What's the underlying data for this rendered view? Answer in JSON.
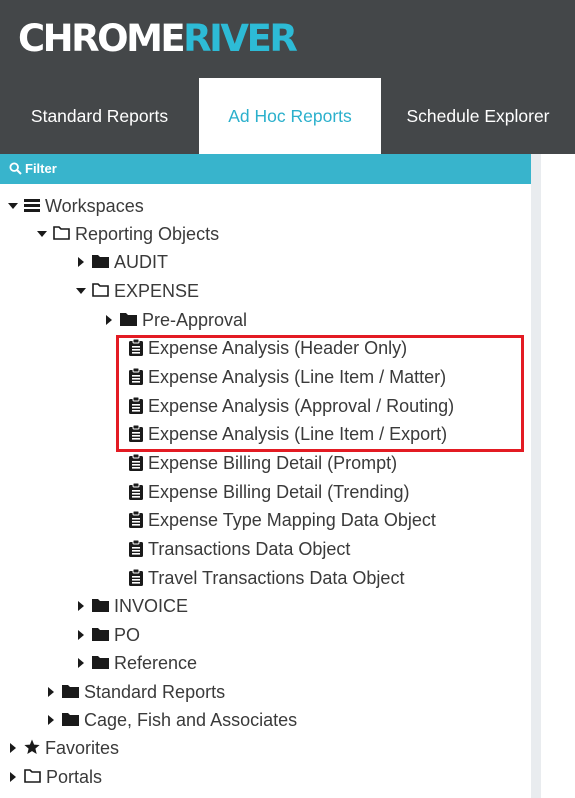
{
  "logo": {
    "part1": "CHROME",
    "part2": "RIVER"
  },
  "tabs": [
    {
      "label": "Standard Reports",
      "active": false
    },
    {
      "label": "Ad Hoc Reports",
      "active": true
    },
    {
      "label": "Schedule Explorer",
      "active": false
    }
  ],
  "filter": {
    "label": "Filter"
  },
  "tree": {
    "workspaces": "Workspaces",
    "reporting_objects": "Reporting Objects",
    "audit": "AUDIT",
    "expense": "EXPENSE",
    "pre_approval": "Pre-Approval",
    "items": [
      "Expense Analysis (Header Only)",
      "Expense Analysis (Line Item / Matter)",
      "Expense Analysis (Approval / Routing)",
      "Expense Analysis (Line Item / Export)",
      "Expense Billing Detail (Prompt)",
      "Expense Billing Detail (Trending)",
      "Expense Type Mapping Data Object",
      "Transactions Data Object",
      "Travel Transactions Data Object"
    ],
    "invoice": "INVOICE",
    "po": "PO",
    "reference": "Reference",
    "standard_reports": "Standard Reports",
    "cage": "Cage, Fish and Associates",
    "favorites": "Favorites",
    "portals": "Portals"
  },
  "colors": {
    "header_bg": "#444749",
    "accent": "#38b4cc",
    "highlight": "#e31b23"
  }
}
